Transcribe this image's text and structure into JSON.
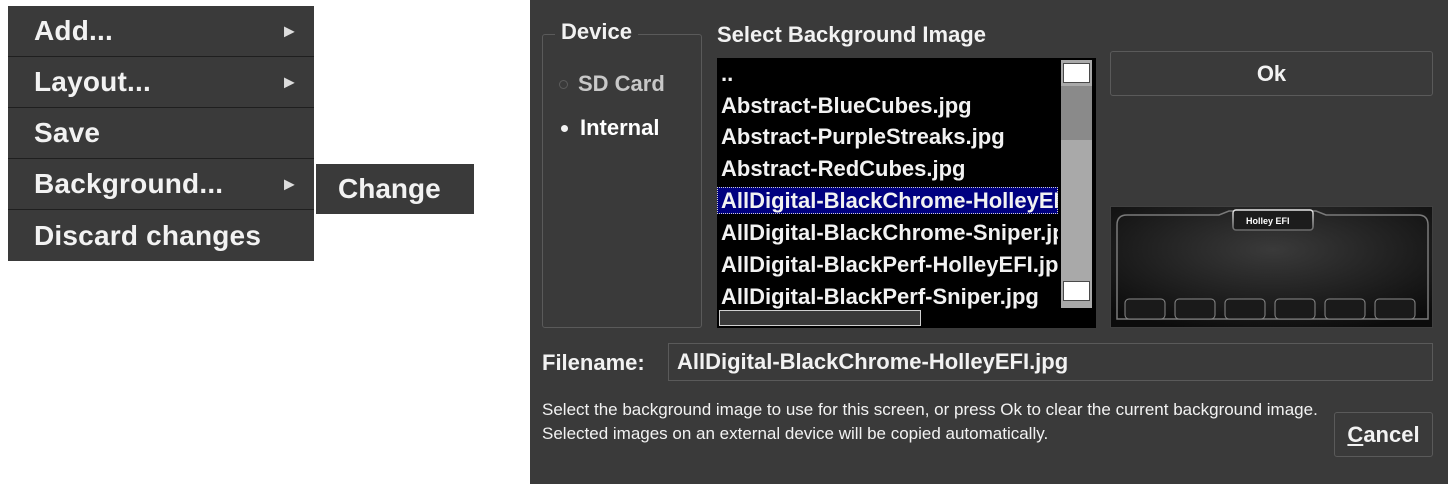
{
  "context_menu": {
    "items": [
      {
        "label": "Add...",
        "has_submenu": true
      },
      {
        "label": "Layout...",
        "has_submenu": true
      },
      {
        "label": "Save",
        "has_submenu": false
      },
      {
        "label": "Background...",
        "has_submenu": true
      },
      {
        "label": "Discard changes",
        "has_submenu": false
      }
    ],
    "submenu": {
      "label": "Change"
    }
  },
  "dialog": {
    "device": {
      "legend": "Device",
      "options": [
        {
          "label": "SD Card",
          "selected": false
        },
        {
          "label": "Internal",
          "selected": true
        }
      ]
    },
    "file_list": {
      "title": "Select Background Image",
      "items": [
        "..",
        "Abstract-BlueCubes.jpg",
        "Abstract-PurpleStreaks.jpg",
        "Abstract-RedCubes.jpg",
        "AllDigital-BlackChrome-HolleyEFI.jpg",
        "AllDigital-BlackChrome-Sniper.jpg",
        "AllDigital-BlackPerf-HolleyEFI.jpg",
        "AllDigital-BlackPerf-Sniper.jpg"
      ],
      "selected_index": 4
    },
    "ok_label": "Ok",
    "preview": {
      "logo_text": "Holley EFI"
    },
    "filename": {
      "label": "Filename:",
      "value": "AllDigital-BlackChrome-HolleyEFI.jpg"
    },
    "hint": "Select the background image to use for this screen, or press Ok to clear the current background image. Selected images on an external device will be copied automatically.",
    "cancel": {
      "mnemonic": "C",
      "rest": "ancel"
    }
  },
  "colors": {
    "panel": "#3a3a3a",
    "list_bg": "#000000",
    "selection": "#000080",
    "text": "#f2f2f2"
  }
}
